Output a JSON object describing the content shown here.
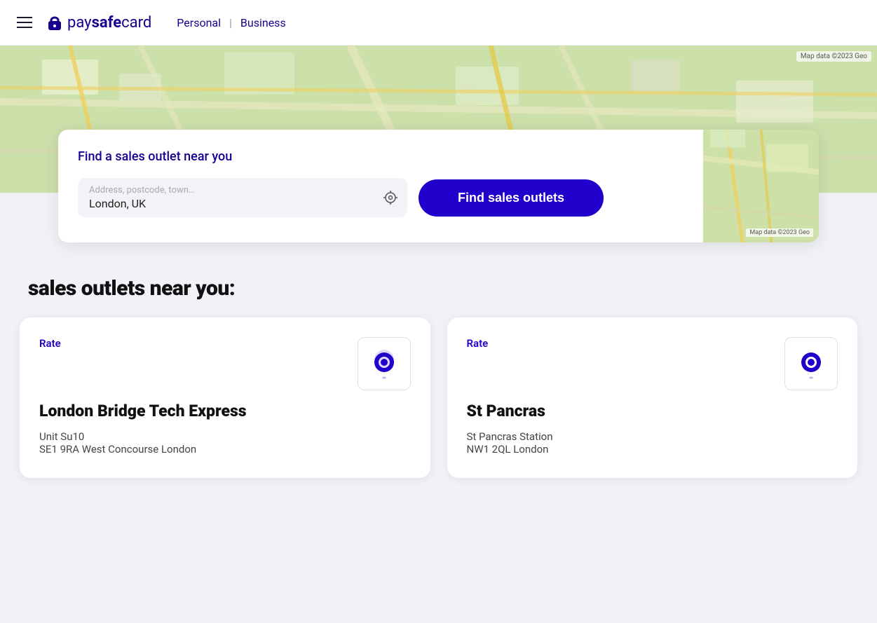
{
  "header": {
    "hamburger_label": "menu",
    "logo_text": "paysafecard",
    "nav_personal": "Personal",
    "nav_divider": "|",
    "nav_business": "Business"
  },
  "search": {
    "find_label": "Find a sales outlet near you",
    "input_placeholder": "Address, postcode, town…",
    "input_value": "London, UK",
    "button_label": "Find sales outlets",
    "location_icon": "⊕"
  },
  "results": {
    "section_title": "sales outlets near you:",
    "outlets": [
      {
        "rate_label": "Rate",
        "name": "London Bridge Tech Express",
        "address_line1": "Unit Su10",
        "address_line2": "SE1 9RA West Concourse London"
      },
      {
        "rate_label": "Rate",
        "name": "St Pancras",
        "address_line1": "St Pancras Station",
        "address_line2": "NW1 2QL London"
      }
    ]
  },
  "map": {
    "attribution": "Map data ©2023 Geo"
  },
  "colors": {
    "brand_blue": "#2200cc",
    "text_dark": "#111111",
    "text_muted": "#888888"
  }
}
